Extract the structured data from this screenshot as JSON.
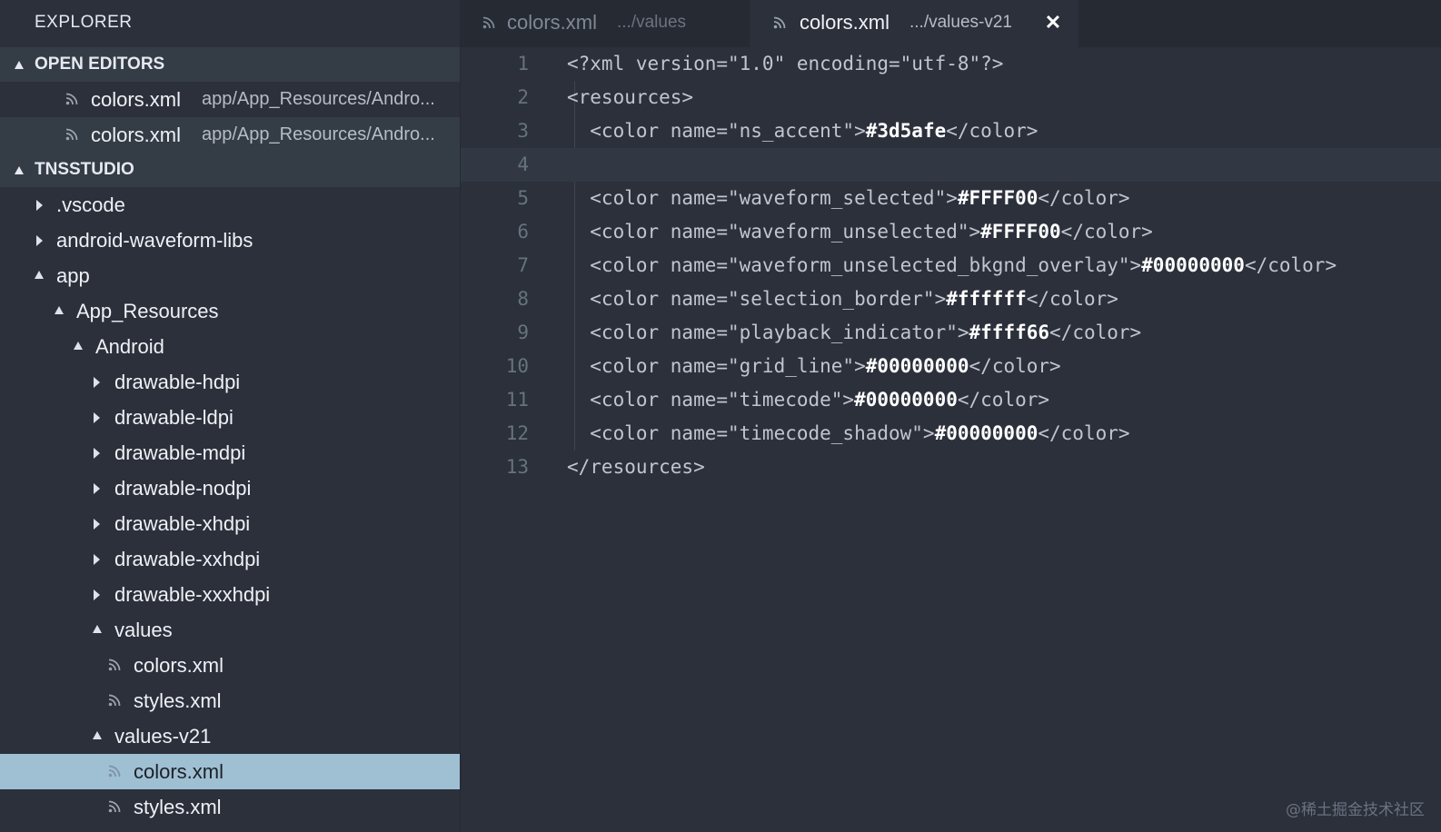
{
  "sidebar": {
    "title": "EXPLORER",
    "open_editors_header": "OPEN EDITORS",
    "open_editors": [
      {
        "name": "colors.xml",
        "path": "app/App_Resources/Andro..."
      },
      {
        "name": "colors.xml",
        "path": "app/App_Resources/Andro..."
      }
    ],
    "project_header": "TNSSTUDIO",
    "tree": [
      {
        "label": ".vscode"
      },
      {
        "label": "android-waveform-libs"
      },
      {
        "label": "app"
      },
      {
        "label": "App_Resources"
      },
      {
        "label": "Android"
      },
      {
        "label": "drawable-hdpi"
      },
      {
        "label": "drawable-ldpi"
      },
      {
        "label": "drawable-mdpi"
      },
      {
        "label": "drawable-nodpi"
      },
      {
        "label": "drawable-xhdpi"
      },
      {
        "label": "drawable-xxhdpi"
      },
      {
        "label": "drawable-xxxhdpi"
      },
      {
        "label": "values"
      },
      {
        "label": "colors.xml"
      },
      {
        "label": "styles.xml"
      },
      {
        "label": "values-v21"
      },
      {
        "label": "colors.xml"
      },
      {
        "label": "styles.xml"
      }
    ]
  },
  "tabs": [
    {
      "name": "colors.xml",
      "path": ".../values"
    },
    {
      "name": "colors.xml",
      "path": ".../values-v21",
      "close": "✕"
    }
  ],
  "code": {
    "line_numbers": [
      "1",
      "2",
      "3",
      "4",
      "5",
      "6",
      "7",
      "8",
      "9",
      "10",
      "11",
      "12",
      "13"
    ],
    "lines": [
      {
        "pre": "<?xml version=\"1.0\" encoding=\"utf-8\"?>",
        "val": "",
        "post": ""
      },
      {
        "pre": "<resources>",
        "val": "",
        "post": ""
      },
      {
        "pre": "  <color name=\"ns_accent\">",
        "val": "#3d5afe",
        "post": "</color>"
      },
      {
        "pre": "",
        "val": "",
        "post": ""
      },
      {
        "pre": "  <color name=\"waveform_selected\">",
        "val": "#FFFF00",
        "post": "</color>"
      },
      {
        "pre": "  <color name=\"waveform_unselected\">",
        "val": "#FFFF00",
        "post": "</color>"
      },
      {
        "pre": "  <color name=\"waveform_unselected_bkgnd_overlay\">",
        "val": "#00000000",
        "post": "</color>"
      },
      {
        "pre": "  <color name=\"selection_border\">",
        "val": "#ffffff",
        "post": "</color>"
      },
      {
        "pre": "  <color name=\"playback_indicator\">",
        "val": "#ffff66",
        "post": "</color>"
      },
      {
        "pre": "  <color name=\"grid_line\">",
        "val": "#00000000",
        "post": "</color>"
      },
      {
        "pre": "  <color name=\"timecode\">",
        "val": "#00000000",
        "post": "</color>"
      },
      {
        "pre": "  <color name=\"timecode_shadow\">",
        "val": "#00000000",
        "post": "</color>"
      },
      {
        "pre": "</resources>",
        "val": "",
        "post": ""
      }
    ]
  },
  "watermark": "@稀土掘金技术社区",
  "colors": {
    "background": "#2b303b",
    "selection": "#9fbfd3",
    "header": "#343d46"
  }
}
